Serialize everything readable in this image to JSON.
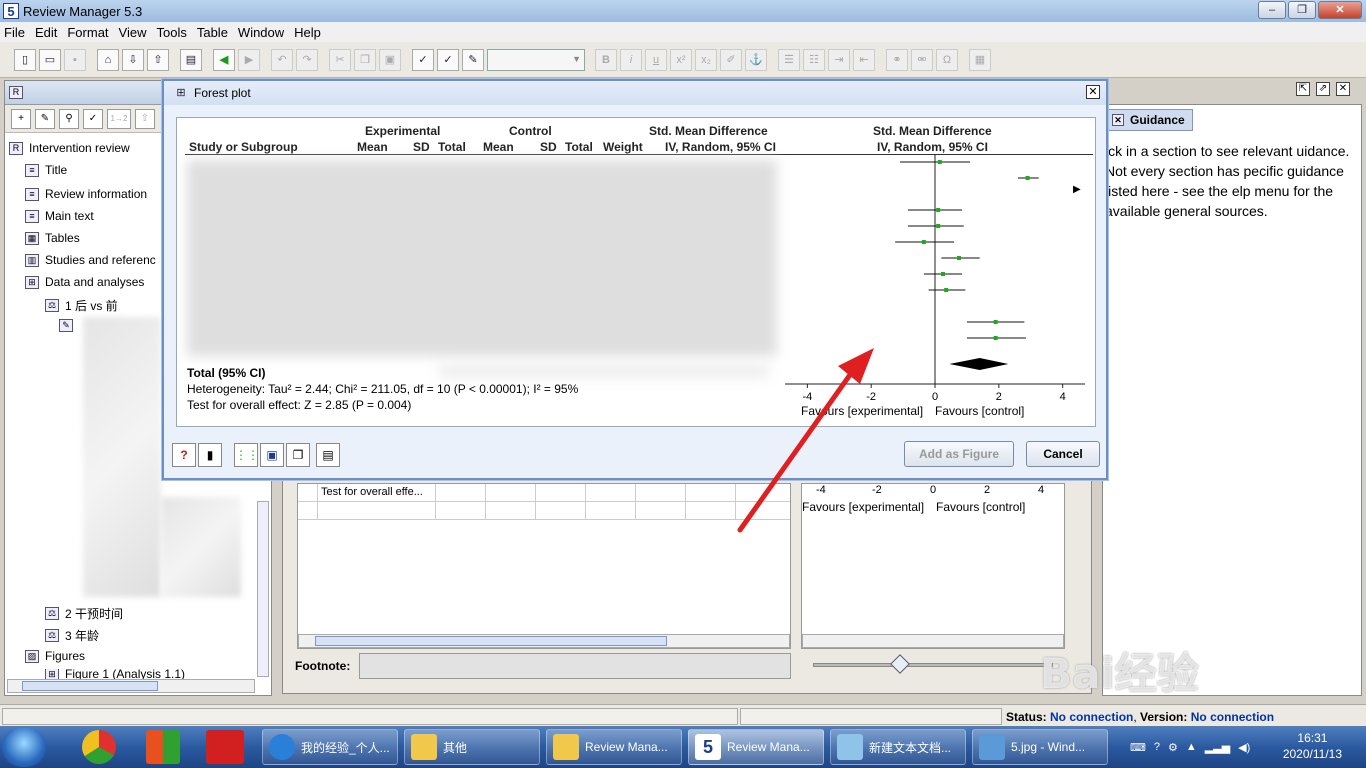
{
  "window": {
    "title": "Review Manager 5.3",
    "app_icon": "5",
    "min": "–",
    "max": "❐",
    "close": "✕"
  },
  "menu": [
    "File",
    "Edit",
    "Format",
    "View",
    "Tools",
    "Table",
    "Window",
    "Help"
  ],
  "tree": {
    "items": [
      "Intervention review",
      "Title",
      "Review information",
      "Main text",
      "Tables",
      "Studies and referenc",
      "Data and analyses",
      "1 后 vs 前",
      "2 干预时间",
      "3 年龄",
      "Figures",
      "Figure 1 (Analysis 1.1)"
    ]
  },
  "guidance": {
    "tab": "Guidance",
    "text": "ick in a section to see relevant uidance. Not every section has pecific guidance listed here - see the elp menu for the available general sources."
  },
  "background": {
    "table_cell": "Test for overall effe...",
    "footnote_label": "Footnote:",
    "ticks": [
      "-4",
      "-2",
      "0",
      "2",
      "4"
    ],
    "favours_exp": "Favours [experimental]",
    "favours_ctrl": "Favours [control]"
  },
  "dialog": {
    "title": "Forest plot",
    "headers": {
      "experimental": "Experimental",
      "control": "Control",
      "smd_left": "Std. Mean Difference",
      "smd_right": "Std. Mean Difference",
      "study": "Study or Subgroup",
      "mean1": "Mean",
      "sd1": "SD",
      "total1": "Total",
      "mean2": "Mean",
      "sd2": "SD",
      "total2": "Total",
      "weight": "Weight",
      "method_left": "IV, Random, 95% CI",
      "method_right": "IV, Random, 95% CI"
    },
    "total_label": "Total (95% CI)",
    "heterogeneity": "Heterogeneity: Tau² = 2.44; Chi² = 211.05, df = 10 (P < 0.00001); I² = 95%",
    "overall": "Test for overall effect: Z = 2.85 (P = 0.004)",
    "add_figure": "Add as Figure",
    "cancel": "Cancel"
  },
  "chart_data": {
    "type": "scatter",
    "xlim": [
      -4.7,
      4.7
    ],
    "ticks": [
      -4,
      -2,
      0,
      2,
      4
    ],
    "favours_left": "Favours [experimental]",
    "favours_right": "Favours [control]",
    "studies": [
      {
        "est": 0.15,
        "lo": -1.1,
        "hi": 1.1
      },
      {
        "est": 2.9,
        "lo": 2.6,
        "hi": 3.25
      },
      {
        "est": 0.1,
        "lo": -0.85,
        "hi": 0.85
      },
      {
        "est": 0.1,
        "lo": -0.85,
        "hi": 0.9
      },
      {
        "est": -0.35,
        "lo": -1.25,
        "hi": 0.6
      },
      {
        "est": 0.75,
        "lo": 0.2,
        "hi": 1.4
      },
      {
        "est": 0.25,
        "lo": -0.35,
        "hi": 0.85
      },
      {
        "est": 0.35,
        "lo": -0.2,
        "hi": 0.95
      },
      {
        "est": 1.9,
        "lo": 1.0,
        "hi": 2.8
      },
      {
        "est": 1.9,
        "lo": 1.0,
        "hi": 2.85
      }
    ],
    "total": {
      "est": 1.4,
      "lo": 0.45,
      "hi": 2.3
    }
  },
  "status": {
    "label": "Status:",
    "connection": "No connection",
    "version_label": "Version:",
    "version": "No connection"
  },
  "taskbar": {
    "tasks": [
      "我的经验_个人...",
      "其他",
      "Review Mana...",
      "Review Mana...",
      "新建文本文档...",
      "5.jpg - Wind..."
    ],
    "time": "16:31",
    "date": "2020/11/13"
  }
}
